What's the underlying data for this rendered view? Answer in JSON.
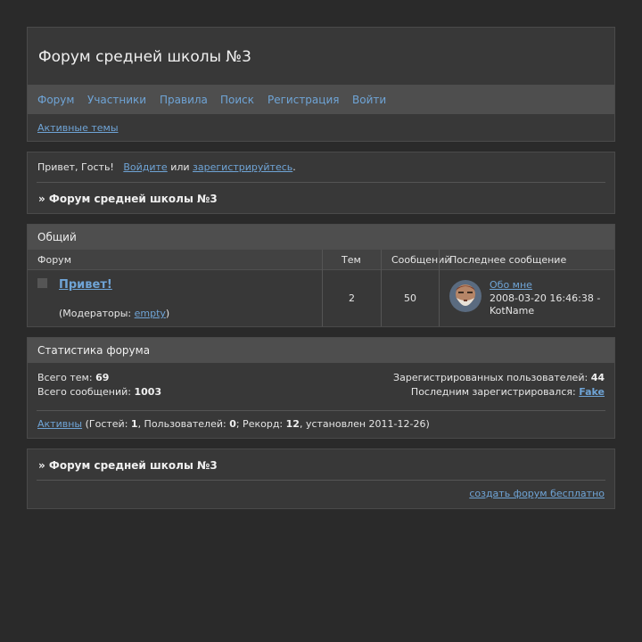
{
  "header": {
    "title": "Форум средней школы №3",
    "nav": [
      "Форум",
      "Участники",
      "Правила",
      "Поиск",
      "Регистрация",
      "Войти"
    ],
    "sub_link": "Активные темы"
  },
  "welcome": {
    "greeting": "Привет, Гость!",
    "login": "Войдите",
    "or": "или",
    "register": "зарегистрируйтесь",
    "dot": ".",
    "crumb": "» Форум средней школы №3"
  },
  "forums": {
    "category": "Общий",
    "headers": {
      "forum": "Форум",
      "topics": "Тем",
      "posts": "Сообщений",
      "last": "Последнее сообщение"
    },
    "rows": [
      {
        "name": "Привет!",
        "moderators_prefix": "(Модераторы:",
        "moderator": "empty",
        "moderators_suffix": ")",
        "topics": "2",
        "posts": "50",
        "last_link": "Обо мне",
        "last_date": "2008-03-20 16:46:38 -",
        "last_user": "KotName"
      }
    ]
  },
  "stats": {
    "title": "Статистика форума",
    "topics_label": "Всего тем:",
    "topics_value": "69",
    "posts_label": "Всего сообщений:",
    "posts_value": "1003",
    "users_label": "Зарегистрированных пользователей:",
    "users_value": "44",
    "last_reg_label": "Последним зарегистрировался:",
    "last_reg_user": "Fake",
    "active_link": "Активны",
    "guests_label": "(Гостей:",
    "guests_value": "1",
    "members_label": ", Пользователей:",
    "members_value": "0",
    "record_label": "; Рекорд:",
    "record_value": "12",
    "record_suffix": ", установлен 2011-12-26)"
  },
  "footer": {
    "crumb": "» Форум средней школы №3",
    "create_link": "создать форум бесплатно"
  },
  "colors": {
    "background": "#2a2a2a",
    "panel": "#383838",
    "bar": "#4e4e4e",
    "link": "#6fa4d6"
  }
}
